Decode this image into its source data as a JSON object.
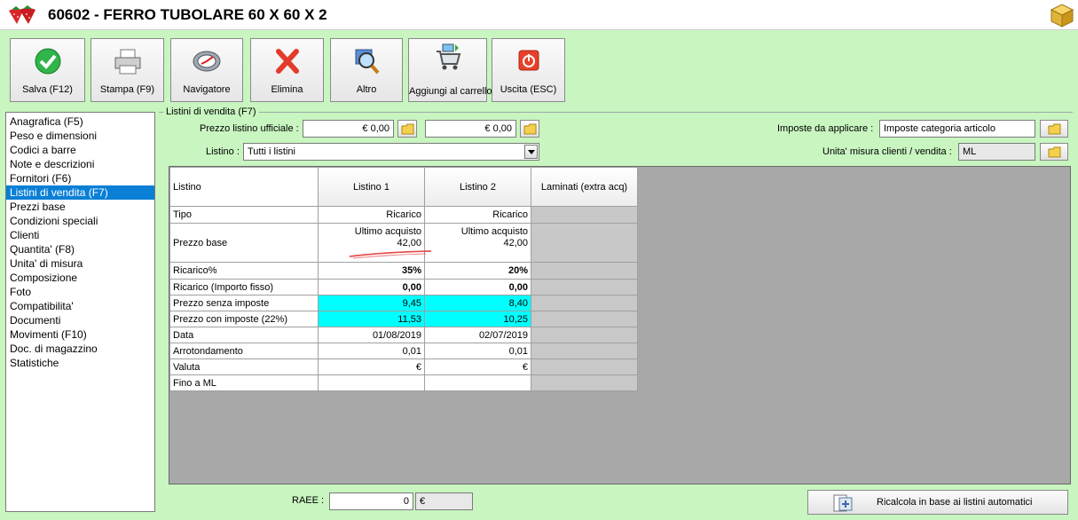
{
  "window": {
    "title": "60602 - FERRO TUBOLARE 60 X 60 X 2"
  },
  "toolbar": {
    "save": "Salva (F12)",
    "print": "Stampa (F9)",
    "navigator": "Navigatore",
    "delete": "Elimina",
    "other": "Altro",
    "add_to_cart": "Aggiungi al carrello",
    "exit": "Uscita (ESC)"
  },
  "nav": {
    "items": [
      "Anagrafica (F5)",
      "Peso e dimensioni",
      "Codici a barre",
      "Note e descrizioni",
      "Fornitori (F6)",
      "Listini di vendita (F7)",
      "Prezzi base",
      "Condizioni speciali",
      "Clienti",
      "Quantita' (F8)",
      "Unita' di misura",
      "Composizione",
      "Foto",
      "Compatibilita'",
      "Documenti",
      "Movimenti (F10)",
      "Doc. di magazzino",
      "Statistiche"
    ],
    "selected_index": 5
  },
  "section": {
    "title": "Listini di vendita (F7)",
    "official_price_label": "Prezzo listino ufficiale :",
    "official_price_1": "€ 0,00",
    "official_price_2": "€ 0,00",
    "list_label": "Listino :",
    "list_value": "Tutti i listini",
    "taxes_label": "Imposte da applicare :",
    "taxes_value": "Imposte categoria articolo",
    "unit_label": "Unita' misura clienti / vendita :",
    "unit_value": "ML"
  },
  "grid": {
    "corner": "Listino",
    "columns": [
      "Listino 1",
      "Listino 2",
      "Laminati (extra acq)"
    ],
    "rows": [
      {
        "label": "Tipo",
        "v1": "Ricarico",
        "v2": "Ricarico"
      },
      {
        "label": "Prezzo base",
        "v1a": "Ultimo acquisto",
        "v1b": "42,00",
        "v2a": "Ultimo acquisto",
        "v2b": "42,00"
      },
      {
        "label": "Ricarico%",
        "v1": "35%",
        "v2": "20%"
      },
      {
        "label": "Ricarico (Importo fisso)",
        "v1": "0,00",
        "v2": "0,00"
      },
      {
        "label": "Prezzo senza imposte",
        "v1": "9,45",
        "v2": "8,40"
      },
      {
        "label": "Prezzo con imposte (22%)",
        "v1": "11,53",
        "v2": "10,25"
      },
      {
        "label": "Data",
        "v1": "01/08/2019",
        "v2": "02/07/2019"
      },
      {
        "label": "Arrotondamento",
        "v1": "0,01",
        "v2": "0,01"
      },
      {
        "label": "Valuta",
        "v1": "€",
        "v2": "€"
      },
      {
        "label": "Fino a ML",
        "v1": "",
        "v2": ""
      }
    ]
  },
  "footer": {
    "raee_label": "RAEE :",
    "raee_value": "0",
    "raee_currency": "€",
    "recalc_label": "Ricalcola in base ai listini automatici"
  },
  "colors": {
    "background": "#c8f5c0",
    "selected": "#0a7fd6",
    "highlight": "#00ffff",
    "annotation": "#e03030"
  }
}
